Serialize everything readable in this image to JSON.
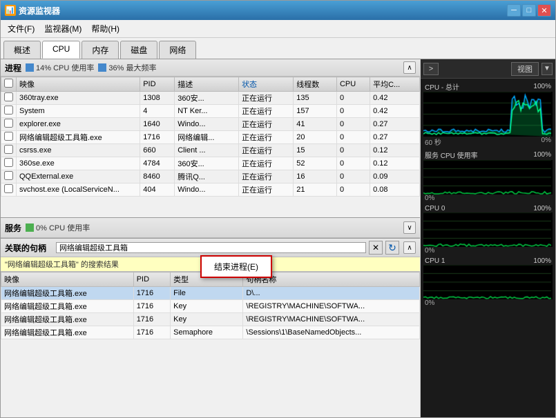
{
  "window": {
    "title": "资源监视器",
    "icon": "📊"
  },
  "menu": {
    "items": [
      {
        "label": "文件(F)"
      },
      {
        "label": "监视器(M)"
      },
      {
        "label": "帮助(H)"
      }
    ]
  },
  "tabs": [
    {
      "label": "概述"
    },
    {
      "label": "CPU",
      "active": true
    },
    {
      "label": "内存"
    },
    {
      "label": "磁盘"
    },
    {
      "label": "网络"
    }
  ],
  "process_section": {
    "title": "进程",
    "cpu_usage": "14% CPU 使用率",
    "max_freq": "36% 最大频率",
    "columns": [
      "映像",
      "PID",
      "描述",
      "状态",
      "线程数",
      "CPU",
      "平均C..."
    ],
    "rows": [
      {
        "image": "360tray.exe",
        "pid": "1308",
        "desc": "360安...",
        "status": "正在运行",
        "threads": "135",
        "cpu": "0",
        "avg": "0.42"
      },
      {
        "image": "System",
        "pid": "4",
        "desc": "NT Ker...",
        "status": "正在运行",
        "threads": "157",
        "cpu": "0",
        "avg": "0.42"
      },
      {
        "image": "explorer.exe",
        "pid": "1640",
        "desc": "Windo...",
        "status": "正在运行",
        "threads": "41",
        "cpu": "0",
        "avg": "0.27"
      },
      {
        "image": "网络编辑超级工具箱.exe",
        "pid": "1716",
        "desc": "网络编辑...",
        "status": "正在运行",
        "threads": "20",
        "cpu": "0",
        "avg": "0.27"
      },
      {
        "image": "csrss.exe",
        "pid": "660",
        "desc": "Client ...",
        "status": "正在运行",
        "threads": "15",
        "cpu": "0",
        "avg": "0.12"
      },
      {
        "image": "360se.exe",
        "pid": "4784",
        "desc": "360安...",
        "status": "正在运行",
        "threads": "52",
        "cpu": "0",
        "avg": "0.12"
      },
      {
        "image": "QQExternal.exe",
        "pid": "8460",
        "desc": "腾讯Q...",
        "status": "正在运行",
        "threads": "16",
        "cpu": "0",
        "avg": "0.09"
      },
      {
        "image": "svchost.exe (LocalServiceN...",
        "pid": "404",
        "desc": "Windo...",
        "status": "正在运行",
        "threads": "21",
        "cpu": "0",
        "avg": "0.08"
      }
    ]
  },
  "services_section": {
    "title": "服务",
    "cpu_usage": "0% CPU 使用率"
  },
  "handles_section": {
    "title": "关联的句柄",
    "search_placeholder": "网络编辑超级工具箱",
    "search_result_label": "\"网络编辑超级工具箱\" 的搜索结果",
    "columns": [
      "映像",
      "PID",
      "类型",
      "句柄名称"
    ],
    "rows": [
      {
        "image": "网络编辑超级工具箱.exe",
        "pid": "1716",
        "type": "File",
        "handle": "D\\..."
      },
      {
        "image": "网络编辑超级工具箱.exe",
        "pid": "1716",
        "type": "Key",
        "handle": "\\REGISTRY\\MACHINE\\SOFTWA..."
      },
      {
        "image": "网络编辑超级工具箱.exe",
        "pid": "1716",
        "type": "Key",
        "handle": "\\REGISTRY\\MACHINE\\SOFTWA..."
      },
      {
        "image": "网络编辑超级工具箱.exe",
        "pid": "1716",
        "type": "Semaphore",
        "handle": "\\Sessions\\1\\BaseNamedObjects..."
      }
    ]
  },
  "context_menu": {
    "items": [
      {
        "label": "结束进程(E)"
      }
    ]
  },
  "right_panel": {
    "expand_btn": ">",
    "view_label": "视图",
    "charts": [
      {
        "label": "CPU - 总计",
        "pct_high": "100%",
        "pct_low": "0%",
        "footer_left": "60 秒",
        "footer_right": "0%",
        "color": "#00aaff",
        "color2": "#00ff88",
        "type": "cpu_total"
      },
      {
        "label": "服务 CPU 使用率",
        "pct_high": "100%",
        "pct_low": "0%",
        "color": "#00cc44",
        "type": "service_cpu"
      },
      {
        "label": "CPU 0",
        "pct_high": "100%",
        "pct_low": "0%",
        "color": "#00cc44",
        "type": "cpu0"
      },
      {
        "label": "CPU 1",
        "pct_high": "100%",
        "pct_low": "0%",
        "color": "#00cc44",
        "type": "cpu1"
      }
    ]
  },
  "title_controls": {
    "minimize": "─",
    "maximize": "□",
    "close": "✕"
  }
}
